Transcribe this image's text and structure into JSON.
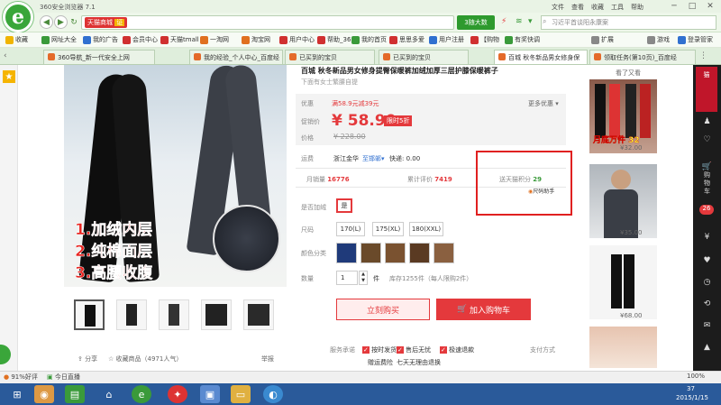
{
  "window": {
    "title": "360安全浏览器 7.1",
    "menus": [
      "文件",
      "查看",
      "收藏",
      "工具",
      "帮助"
    ],
    "controls": [
      "─",
      "□",
      "✕"
    ]
  },
  "logo": {
    "letter": "e"
  },
  "address": {
    "shop_tag": "天猫商城",
    "shop_tag2": "证",
    "url": "",
    "search_button": "3随大数",
    "search_placeholder": "习近平首谈阳永康案"
  },
  "bookmarks": [
    {
      "label": "收藏",
      "color": "#f0b400"
    },
    {
      "label": "网址大全",
      "color": "#3a9a3a"
    },
    {
      "label": "我的广告",
      "color": "#3070d0"
    },
    {
      "label": "会员中心",
      "color": "#d03030"
    },
    {
      "label": "天猫tmall",
      "color": "#d03030"
    },
    {
      "label": "一淘网",
      "color": "#e07020"
    },
    {
      "label": "淘宝网",
      "color": "#e07020"
    },
    {
      "label": "用户中心",
      "color": "#d03030"
    },
    {
      "label": "帮助_36",
      "color": "#d03030"
    },
    {
      "label": "我的首页",
      "color": "#3a9a3a"
    },
    {
      "label": "思思多爱",
      "color": "#d03030"
    },
    {
      "label": "用户注册",
      "color": "#3070d0"
    },
    {
      "label": "【购物",
      "color": "#d03030"
    },
    {
      "label": "有奖快调",
      "color": "#3a9a3a"
    },
    {
      "label": "扩展",
      "color": "#888888"
    },
    {
      "label": "游戏",
      "color": "#888888"
    },
    {
      "label": "登录管家",
      "color": "#3070d0"
    }
  ],
  "tabs": [
    {
      "label": "360导航_新一代安全上网"
    },
    {
      "label": "我的经验_个人中心_百度经"
    },
    {
      "label": "已买到的宝贝"
    },
    {
      "label": "已买到的宝贝"
    },
    {
      "label": "百城 秋冬新品男女修身保"
    },
    {
      "label": "领取任务(第10页)_百度经"
    }
  ],
  "product": {
    "title": "百城 秋冬新品男女修身提臀保暖裤加绒加厚三层护膝保暖裤子",
    "subtitle": "下面有女士繁腰自提",
    "features": [
      "1.加绒内层",
      "2.纯棉面层",
      "3.高腰收腹"
    ],
    "promo_label": "优惠",
    "promo_text": "满58.9元减39元",
    "more_promo": "更多优惠",
    "price_label": "促销价",
    "price": "¥ 58.90",
    "price_tag": "限时5折",
    "orig_label": "价格",
    "orig_price": "¥ 228.00",
    "ship_label": "运费",
    "ship_from": "浙江金华",
    "ship_to": "至邯郸",
    "ship_fee": "快递: 0.00",
    "sales_label": "月销量",
    "sales": "16776",
    "reviews_label": "累计评价",
    "reviews": "7419",
    "points_label": "送天猫积分",
    "points": "29",
    "points_helper": "尺码助手",
    "fleece_label": "是否加绒",
    "fleece_option": "是",
    "size_label": "尺码",
    "sizes": [
      "170(L)",
      "175(XL)",
      "180(XXL)"
    ],
    "color_label": "颜色分类",
    "qty_label": "数量",
    "qty": "1",
    "qty_unit": "件",
    "stock": "库存1255件（每人限购2件）",
    "buy_now": "立刻购买",
    "add_cart": "加入购物车",
    "share": "分享",
    "favorite": "收藏商品（4971人气）",
    "report": "举报",
    "service_label": "服务承诺",
    "services": [
      "按时发货",
      "售后无忧",
      "极速退款",
      "赠运费险",
      "七天无理由退换"
    ],
    "payment_label": "支付方式"
  },
  "recommend": {
    "title": "看了又看",
    "items": [
      {
        "price": "¥32.00",
        "badge": "月底万件 32"
      },
      {
        "price": "¥35.00",
        "badge": ""
      },
      {
        "price": "¥68.00",
        "badge": ""
      },
      {
        "price": "",
        "badge": ""
      }
    ]
  },
  "right_sidebar": {
    "items": [
      "购物车",
      "26"
    ]
  },
  "status": {
    "left": "91%好评",
    "right": "今日直播",
    "zoom": "100%"
  },
  "taskbar": {
    "time": "37",
    "date": "2015/1/15"
  }
}
